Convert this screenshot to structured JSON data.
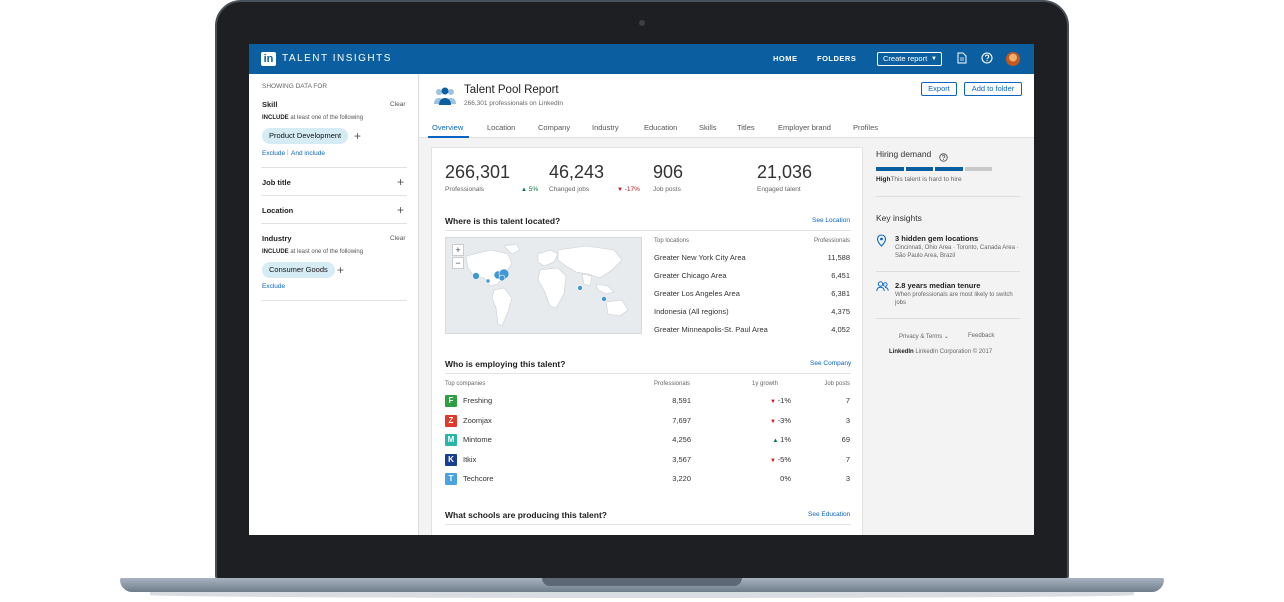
{
  "brand": {
    "logo_text": "in",
    "name": "TALENT INSIGHTS"
  },
  "topnav": {
    "home": "HOME",
    "folders": "FOLDERS",
    "create_report": "Create report",
    "icons": [
      "document-icon",
      "help-icon",
      "avatar"
    ]
  },
  "sidebar": {
    "showing_label": "SHOWING DATA FOR",
    "skill": {
      "title": "Skill",
      "clear": "Clear",
      "include_prefix": "INCLUDE",
      "include_text": "at least one of the following",
      "pill": "Product Development",
      "exclude": "Exclude",
      "and_include": "And include"
    },
    "job_title": {
      "title": "Job title"
    },
    "location": {
      "title": "Location"
    },
    "industry": {
      "title": "Industry",
      "clear": "Clear",
      "include_prefix": "INCLUDE",
      "include_text": "at least one of the following",
      "pill": "Consumer Goods",
      "exclude": "Exclude"
    }
  },
  "header": {
    "title": "Talent Pool Report",
    "subtitle": "266,301 professionals on LinkedIn",
    "export": "Export",
    "add_to_folder": "Add to folder"
  },
  "tabs": [
    "Overview",
    "Location",
    "Company",
    "Industry",
    "Education",
    "Skills",
    "Titles",
    "Employer brand",
    "Profiles"
  ],
  "stats": [
    {
      "value": "266,301",
      "label": "Professionals",
      "delta": "5%",
      "direction": "up"
    },
    {
      "value": "46,243",
      "label": "Changed jobs",
      "delta": "-17%",
      "direction": "down"
    },
    {
      "value": "906",
      "label": "Job posts"
    },
    {
      "value": "21,036",
      "label": "Engaged talent"
    }
  ],
  "location_section": {
    "title": "Where is this talent located?",
    "link": "See Location",
    "col_name": "Top locations",
    "col_value": "Professionals",
    "rows": [
      {
        "name": "Greater New York City Area",
        "value": "11,588"
      },
      {
        "name": "Greater Chicago Area",
        "value": "6,451"
      },
      {
        "name": "Greater Los Angeles Area",
        "value": "6,381"
      },
      {
        "name": "Indonesia (All regions)",
        "value": "4,375"
      },
      {
        "name": "Greater Minneapolis-St. Paul Area",
        "value": "4,052"
      }
    ]
  },
  "company_section": {
    "title": "Who is employing this talent?",
    "link": "See Company",
    "cols": [
      "Top companies",
      "Professionals",
      "1y growth",
      "Job posts"
    ],
    "rows": [
      {
        "name": "Freshing",
        "professionals": "8,591",
        "growth": "-1%",
        "direction": "down",
        "job_posts": "7",
        "logo_color": "#2ea043",
        "logo_glyph": "F"
      },
      {
        "name": "Zoomjax",
        "professionals": "7,697",
        "growth": "-3%",
        "direction": "down",
        "job_posts": "3",
        "logo_color": "#e03a2c",
        "logo_glyph": "Z"
      },
      {
        "name": "Mintome",
        "professionals": "4,256",
        "growth": "1%",
        "direction": "up",
        "job_posts": "69",
        "logo_color": "#26b5a6",
        "logo_glyph": "M"
      },
      {
        "name": "Itkix",
        "professionals": "3,567",
        "growth": "-5%",
        "direction": "down",
        "job_posts": "7",
        "logo_color": "#1a3f8f",
        "logo_glyph": "K"
      },
      {
        "name": "Techcore",
        "professionals": "3,220",
        "growth": "0%",
        "direction": "flat",
        "job_posts": "3",
        "logo_color": "#4aa3df",
        "logo_glyph": "T"
      }
    ]
  },
  "school_section": {
    "title": "What schools are producing this talent?",
    "link": "See Education"
  },
  "right_panel": {
    "hiring_title": "Hiring demand",
    "demand_level": "High",
    "demand_text": "This talent is hard to hire",
    "demand_fraction": 0.75,
    "key_insights_title": "Key insights",
    "insights": [
      {
        "icon": "location-pin-icon",
        "title": "3 hidden gem locations",
        "desc": "Cincinnati, Ohio Area · Toronto, Canada Area · São Paulo Area, Brazil"
      },
      {
        "icon": "people-icon",
        "title": "2.8 years median tenure",
        "desc": "When professionals are most likely to switch jobs"
      }
    ],
    "privacy": "Privacy & Terms",
    "feedback": "Feedback",
    "footer_brand": "LinkedIn",
    "copyright": "LinkedIn Corporation © 2017"
  },
  "colors": {
    "primary": "#0b5fa1",
    "link": "#0a66c2",
    "up": "#057642",
    "down": "#d11124"
  }
}
